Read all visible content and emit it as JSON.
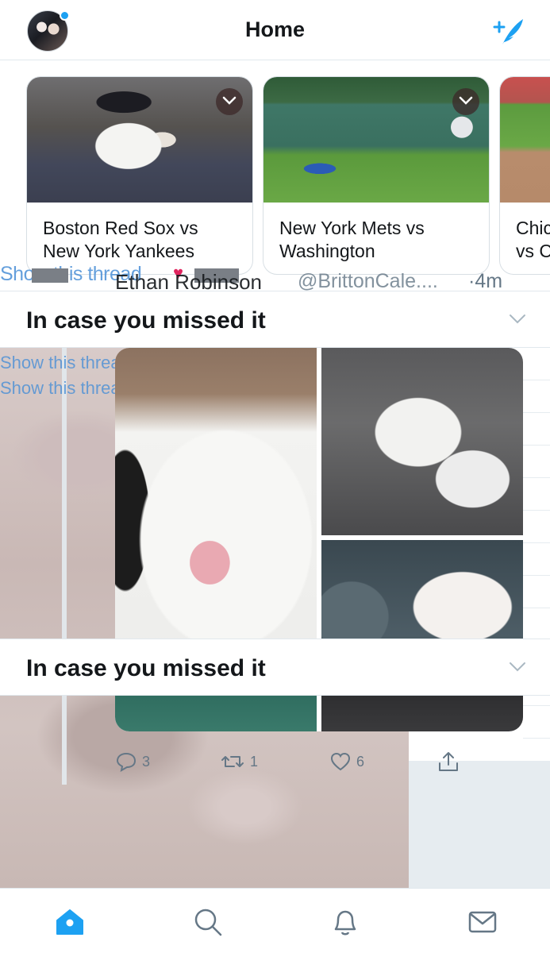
{
  "header": {
    "title": "Home",
    "avatar_icon": "profile-avatar",
    "compose_icon": "compose-tweet-icon",
    "accent": "#1da1f2"
  },
  "cards": [
    {
      "title": "Boston Red Sox vs\nNew York Yankees"
    },
    {
      "title": "New York Mets vs\nWashington"
    },
    {
      "title": "Chic\nvs C"
    }
  ],
  "glitch": {
    "show_thread": "Show this thread",
    "name": "Ethan Robinson",
    "handle": "@BrittonCale....",
    "time": "·4m"
  },
  "sections": [
    {
      "label": "In case you missed it"
    },
    {
      "label": "In case you missed it"
    }
  ],
  "tweet": {
    "replies": "3",
    "retweets": "1",
    "likes": "6"
  },
  "tabbar": {
    "items": [
      "home-icon",
      "search-icon",
      "notifications-icon",
      "messages-icon"
    ],
    "active_color": "#1da1f2",
    "inactive_color": "#657786"
  }
}
